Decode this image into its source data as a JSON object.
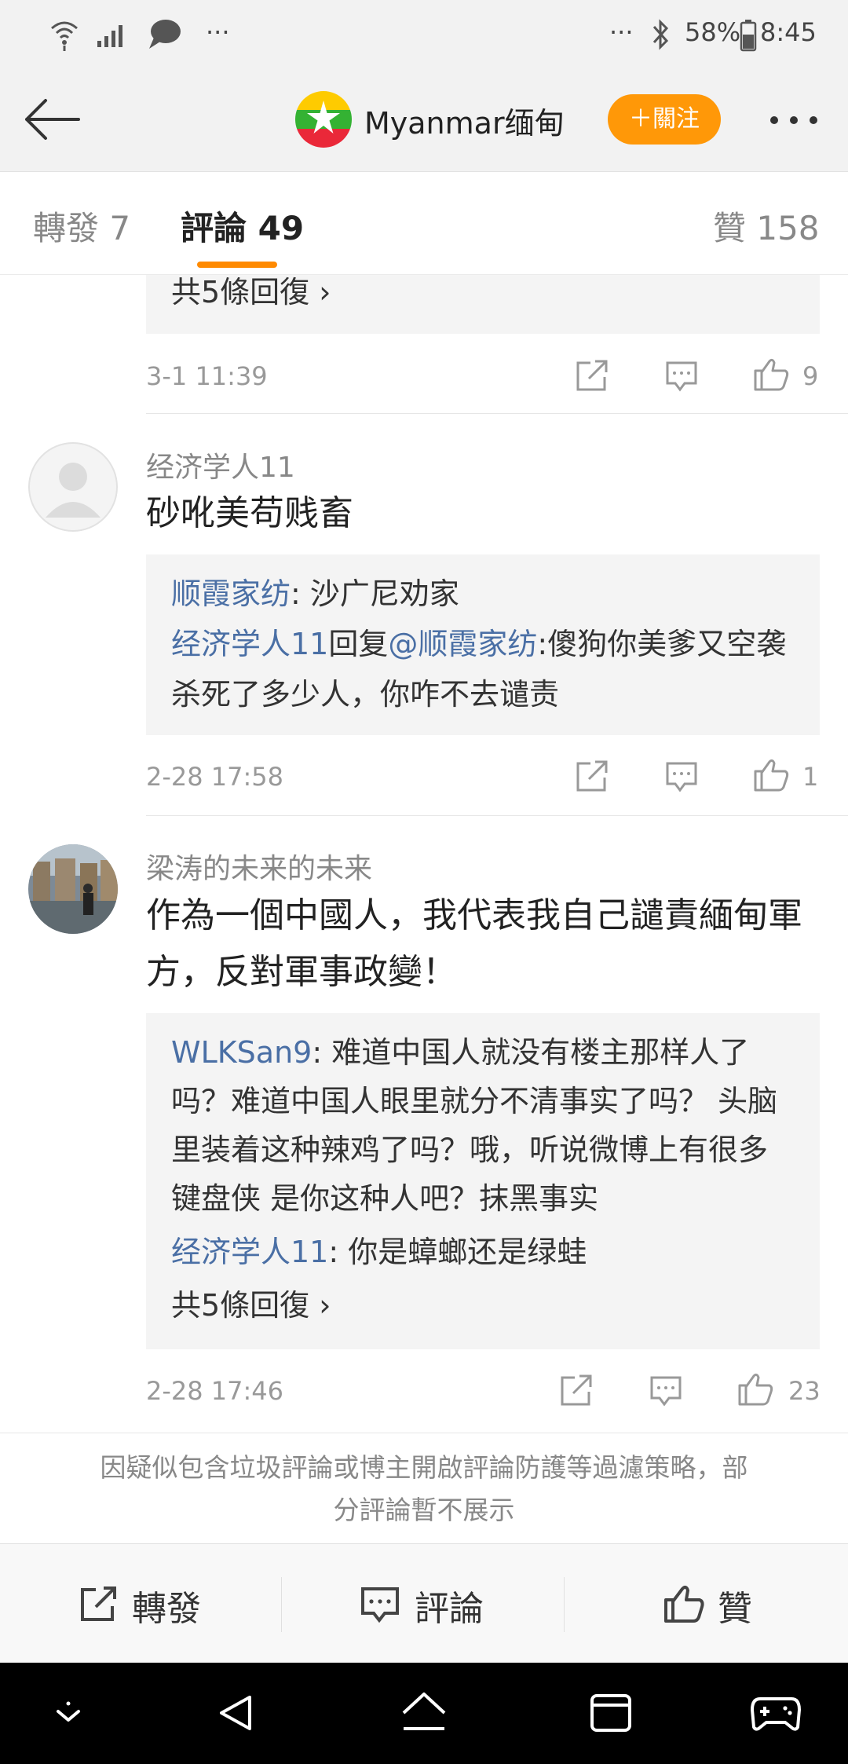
{
  "status_bar": {
    "left_dots": "···",
    "right_dots": "···",
    "battery": "58%",
    "time": "8:45"
  },
  "header": {
    "title": "Myanmar缅甸",
    "follow": "＋關注"
  },
  "tabs": [
    {
      "label": "轉發 7"
    },
    {
      "label": "評論 49"
    },
    {
      "label": "贊 158"
    }
  ],
  "comments": [
    {
      "reply_more": "共5條回復 ›",
      "time": "3-1 11:39",
      "likes": "9"
    },
    {
      "username": "经济学人11",
      "text": "砂吪美苟贱畜",
      "replies": [
        {
          "author": "顺霞家纺",
          "text": ": 沙广尼劝家"
        },
        {
          "author": "经济学人11",
          "middle": "回复",
          "mention": "@顺霞家纺",
          "text": ":傻狗你美爹又空袭",
          "cont": "杀死了多少人，你咋不去谴责"
        }
      ],
      "time": "2-28 17:58",
      "likes": "1"
    },
    {
      "username": "梁涛的未来的未来",
      "text_line1": "作為一個中國人，我代表我自己譴責緬甸軍",
      "text_line2": "方，反對軍事政變！",
      "replies": [
        {
          "author": "WLKSan9",
          "text": ": 难道中国人就没有楼主那样人了",
          "l2": "吗？难道中国人眼里就分不清事实了吗？ 头脑",
          "l3": "里装着这种辣鸡了吗？哦，听说微博上有很多",
          "l4": "键盘侠 是你这种人吧？抹黑事实"
        },
        {
          "author": "经济学人11",
          "text": ": 你是蟑螂还是绿蛙"
        }
      ],
      "reply_more": "共5條回復 ›",
      "time": "2-28 17:46",
      "likes": "23"
    }
  ],
  "notice": {
    "line1": "因疑似包含垃圾評論或博主開啟評論防護等過濾策略，部",
    "line2": "分評論暫不展示"
  },
  "bottom_bar": {
    "repost": "轉發",
    "comment": "評論",
    "like": "贊"
  },
  "colors": {
    "accent": "#ff9808",
    "link": "#4a6fa5"
  }
}
